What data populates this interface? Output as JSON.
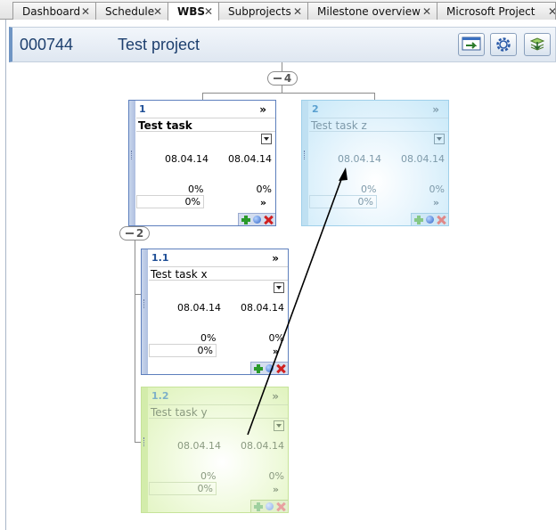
{
  "tabs": [
    {
      "label": "Dashboard",
      "active": false
    },
    {
      "label": "Schedule",
      "active": false
    },
    {
      "label": "WBS",
      "active": true
    },
    {
      "label": "Subprojects",
      "active": false
    },
    {
      "label": "Milestone overview",
      "active": false
    },
    {
      "label": "Microsoft Project",
      "active": false
    }
  ],
  "header": {
    "project_id": "000744",
    "project_name": "Test project",
    "buttons": [
      "export-icon",
      "gear-icon",
      "layers-icon"
    ]
  },
  "tree": {
    "root_collapse_count": "4",
    "child_collapse_count": "2"
  },
  "tasks": [
    {
      "number": "1",
      "more": "»",
      "name": "Test task",
      "start": "08.04.14",
      "end": "08.04.14",
      "progress_a": "0%",
      "progress_b": "0%",
      "progress_box": "0%",
      "more_bottom": "»",
      "style": "normal"
    },
    {
      "number": "2",
      "more": "»",
      "name": "Test task z",
      "start": "08.04.14",
      "end": "08.04.14",
      "progress_a": "0%",
      "progress_b": "0%",
      "progress_box": "0%",
      "more_bottom": "»",
      "style": "blue"
    },
    {
      "number": "1.1",
      "more": "»",
      "name": "Test task x",
      "start": "08.04.14",
      "end": "08.04.14",
      "progress_a": "0%",
      "progress_b": "0%",
      "progress_box": "0%",
      "more_bottom": "»",
      "style": "normal"
    },
    {
      "number": "1.2",
      "more": "»",
      "name": "Test task y",
      "start": "08.04.14",
      "end": "08.04.14",
      "progress_a": "0%",
      "progress_b": "0%",
      "progress_box": "0%",
      "more_bottom": "»",
      "style": "green"
    }
  ],
  "colors": {
    "accent": "#6f95c4",
    "card_border": "#5d7fbd",
    "drag_blue": "#c7e8f8",
    "drag_green": "#ddf2b8",
    "title_text": "#1d3f6e"
  }
}
